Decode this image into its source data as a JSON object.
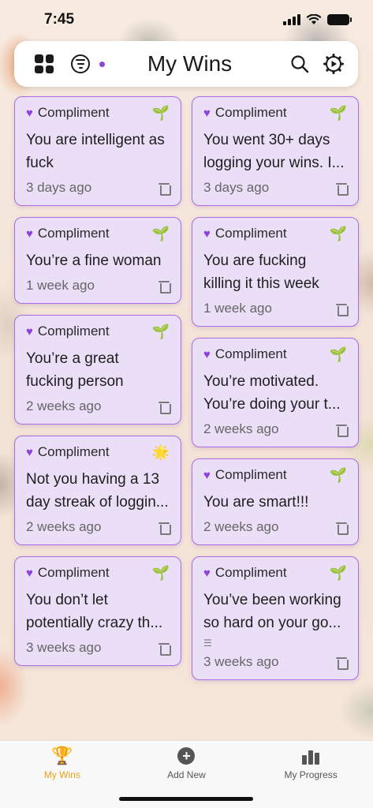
{
  "status": {
    "time": "7:45"
  },
  "header": {
    "title": "My Wins"
  },
  "left_cards": [
    {
      "category": "Compliment",
      "text": "You are intelligent as fuck",
      "when": "3 days ago",
      "badge": "🌱"
    },
    {
      "category": "Compliment",
      "text": "You’re a fine woman",
      "when": "1 week ago",
      "badge": "🌱"
    },
    {
      "category": "Compliment",
      "text": "You’re a great fucking person",
      "when": "2 weeks ago",
      "badge": "🌱"
    },
    {
      "category": "Compliment",
      "text": "Not you having a 13 day streak of loggin...",
      "when": "2 weeks ago",
      "badge": "🌟"
    },
    {
      "category": "Compliment",
      "text": "You don’t let potentially crazy th...",
      "when": "3 weeks ago",
      "badge": "🌱"
    }
  ],
  "right_cards": [
    {
      "category": "Compliment",
      "text": "You went 30+ days logging your wins. I...",
      "when": "3 days ago",
      "badge": "🌱"
    },
    {
      "category": "Compliment",
      "text": "You are fucking killing it this week",
      "when": "1 week ago",
      "badge": "🌱"
    },
    {
      "category": "Compliment",
      "text": "You’re motivated. You’re doing your t...",
      "when": "2 weeks ago",
      "badge": "🌱"
    },
    {
      "category": "Compliment",
      "text": "You are smart!!!",
      "when": "2 weeks ago",
      "badge": "🌱"
    },
    {
      "category": "Compliment",
      "text": "You’ve been working so hard on your go...",
      "when": "3 weeks ago",
      "badge": "🌱"
    }
  ],
  "tabs": [
    {
      "label": "My Wins",
      "active": true
    },
    {
      "label": "Add New",
      "active": false
    },
    {
      "label": "My Progress",
      "active": false
    }
  ],
  "colors": {
    "accent": "#8e44d8",
    "card_bg": "#ebdff8",
    "card_border": "#a96ee0",
    "tab_active": "#e9a317"
  }
}
